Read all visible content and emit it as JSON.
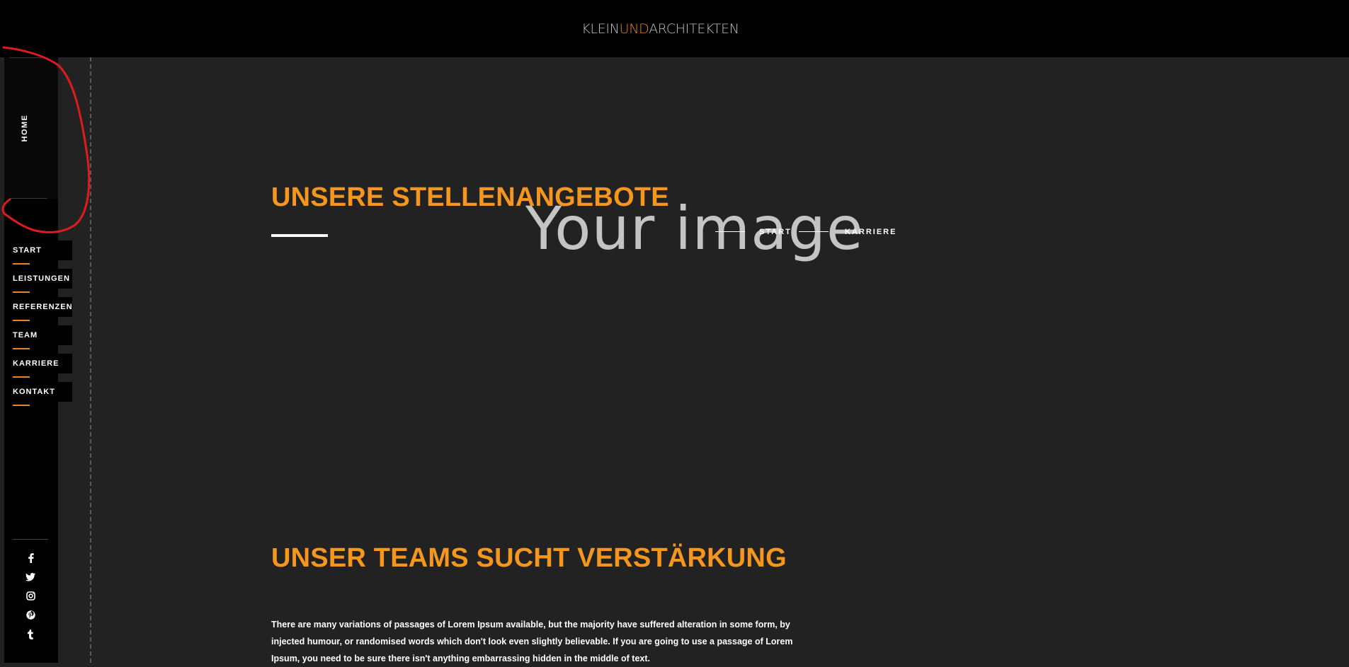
{
  "header": {
    "logo": {
      "part1": "KLEIN",
      "part2": "UND",
      "part3": "ARCHITEKTEN"
    }
  },
  "sidebar": {
    "home_label": "HOME",
    "nav_items": [
      {
        "label": "START"
      },
      {
        "label": "LEISTUNGEN"
      },
      {
        "label": "REFERENZEN"
      },
      {
        "label": "TEAM"
      },
      {
        "label": "KARRIERE"
      },
      {
        "label": "KONTAKT"
      }
    ],
    "social_icons": [
      "facebook-icon",
      "twitter-icon",
      "instagram-icon",
      "pinterest-icon",
      "tumblr-icon"
    ]
  },
  "main": {
    "hero_title": "UNSERE STELLENANGEBOTE",
    "image_placeholder": "Your image",
    "breadcrumb": {
      "start": "START",
      "current": "KARRIERE"
    },
    "section_title": "UNSER TEAMS SUCHT VERSTÄRKUNG",
    "paragraph": "There are many variations of passages of Lorem Ipsum available, but the majority have suffered alteration in some form, by injected humour, or randomised words which don't look even slightly believable. If you are going to use a passage of Lorem Ipsum, you need to be sure there isn't anything embarrassing hidden in the middle of text."
  },
  "colors": {
    "accent": "#f5961e",
    "background": "#222222",
    "sidebar": "#000000",
    "annotation": "#e01b1b"
  }
}
